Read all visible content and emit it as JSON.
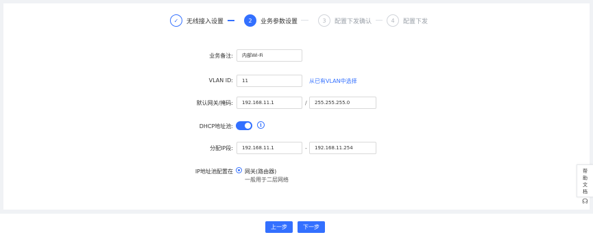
{
  "steps": [
    {
      "num": "✓",
      "label": "无线接入设置",
      "state": "done"
    },
    {
      "num": "2",
      "label": "业务参数设置",
      "state": "active"
    },
    {
      "num": "3",
      "label": "配置下发确认",
      "state": "todo"
    },
    {
      "num": "4",
      "label": "配置下发",
      "state": "todo"
    }
  ],
  "form": {
    "remark_label": "业务备注:",
    "remark_value": "内部Wi-Fi",
    "vlan_label": "VLAN ID:",
    "vlan_value": "11",
    "vlan_link": "从已有VLAN中选择",
    "gateway_label": "默认网关/掩码:",
    "gateway_value": "192.168.11.1",
    "gateway_sep": "/",
    "mask_value": "255.255.255.0",
    "dhcp_label": "DHCP地址池:",
    "dhcp_enabled": true,
    "range_label": "分配IP段:",
    "range_start": "192.168.11.1",
    "range_sep": "-",
    "range_end": "192.168.11.254",
    "pool_label": "IP地址池配置在",
    "pool_option": "网关(路由器)",
    "pool_desc": "一般用于二层网络"
  },
  "footer": {
    "prev_label": "上一步",
    "next_label": "下一步"
  },
  "help": {
    "label": "帮助文档",
    "icon": "headset-icon"
  },
  "colors": {
    "accent": "#3370ff"
  }
}
